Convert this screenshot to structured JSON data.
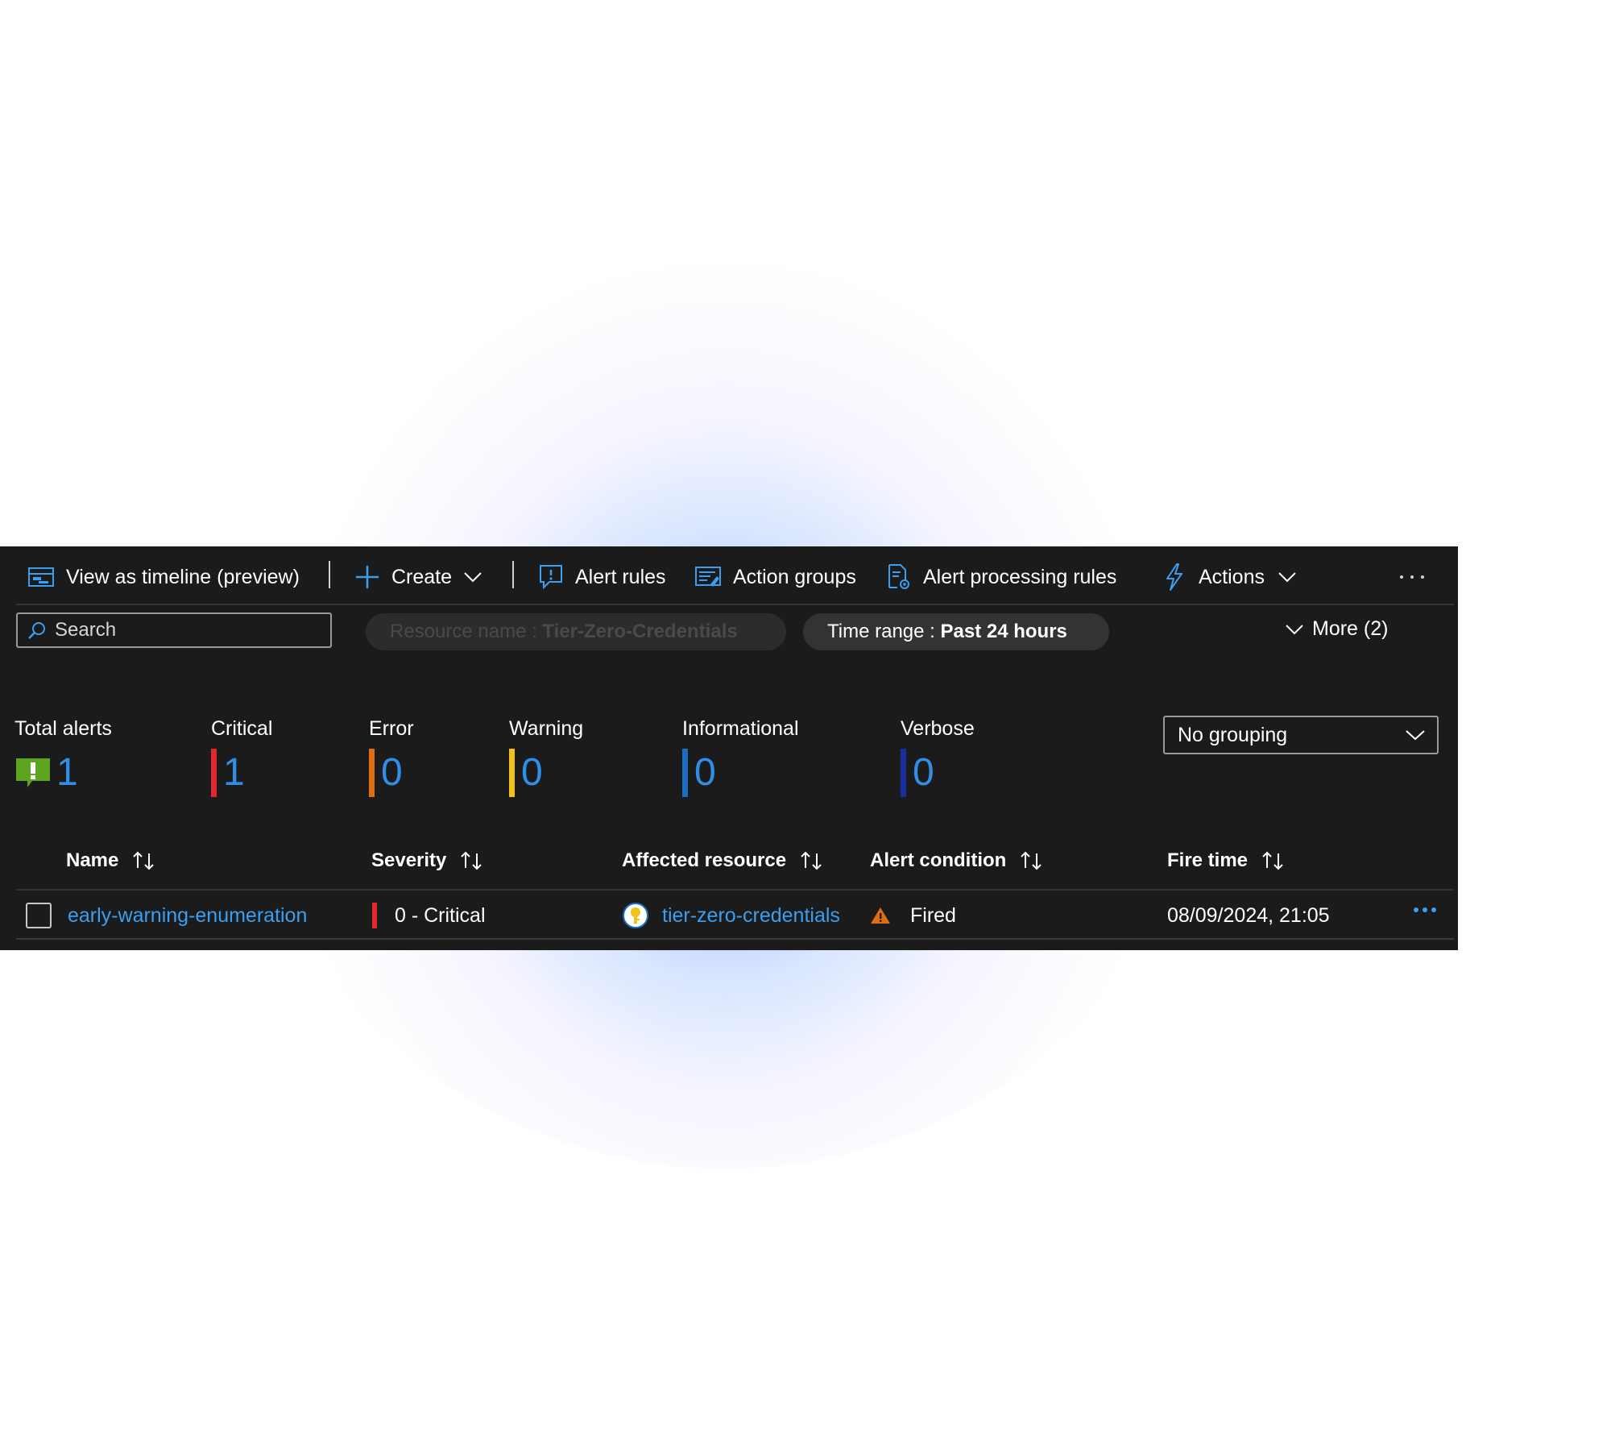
{
  "toolbar": {
    "timeline_label": "View as timeline (preview)",
    "create_label": "Create",
    "alert_rules_label": "Alert rules",
    "action_groups_label": "Action groups",
    "processing_rules_label": "Alert processing rules",
    "actions_label": "Actions",
    "overflow_icon": "more-horizontal-icon"
  },
  "filters": {
    "search_placeholder": "Search",
    "resource_prefix": "Resource name : ",
    "resource_value": "Tier-Zero-Credentials",
    "time_prefix": "Time range : ",
    "time_value": "Past 24 hours",
    "more_label": "More (2)"
  },
  "summary": {
    "total": {
      "label": "Total alerts",
      "value": "1"
    },
    "critical": {
      "label": "Critical",
      "value": "1",
      "color": "#e3262f"
    },
    "error": {
      "label": "Error",
      "value": "0",
      "color": "#e06d10"
    },
    "warning": {
      "label": "Warning",
      "value": "0",
      "color": "#f2c21b"
    },
    "informational": {
      "label": "Informational",
      "value": "0",
      "color": "#1b6ec2"
    },
    "verbose": {
      "label": "Verbose",
      "value": "0",
      "color": "#1a2f9e"
    }
  },
  "grouping": {
    "selected": "No grouping"
  },
  "table": {
    "columns": [
      "Name",
      "Severity",
      "Affected resource",
      "Alert condition",
      "Fire time"
    ],
    "rows": [
      {
        "name": "early-warning-enumeration",
        "severity": "0 - Critical",
        "resource": "tier-zero-credentials",
        "condition": "Fired",
        "fire_time": "08/09/2024, 21:05"
      }
    ]
  },
  "colors": {
    "panel_bg": "#1b1b1b",
    "accent": "#2f8fe8",
    "link": "#3a9ff0"
  }
}
